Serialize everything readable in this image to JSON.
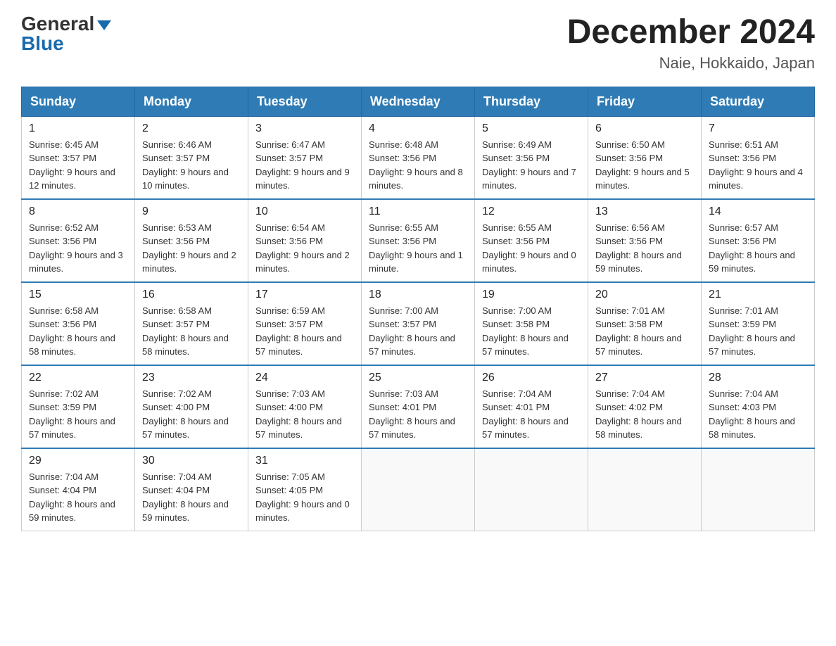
{
  "header": {
    "logo_general": "General",
    "logo_blue": "Blue",
    "month_title": "December 2024",
    "location": "Naie, Hokkaido, Japan"
  },
  "weekdays": [
    "Sunday",
    "Monday",
    "Tuesday",
    "Wednesday",
    "Thursday",
    "Friday",
    "Saturday"
  ],
  "weeks": [
    [
      {
        "day": "1",
        "sunrise": "6:45 AM",
        "sunset": "3:57 PM",
        "daylight": "9 hours and 12 minutes."
      },
      {
        "day": "2",
        "sunrise": "6:46 AM",
        "sunset": "3:57 PM",
        "daylight": "9 hours and 10 minutes."
      },
      {
        "day": "3",
        "sunrise": "6:47 AM",
        "sunset": "3:57 PM",
        "daylight": "9 hours and 9 minutes."
      },
      {
        "day": "4",
        "sunrise": "6:48 AM",
        "sunset": "3:56 PM",
        "daylight": "9 hours and 8 minutes."
      },
      {
        "day": "5",
        "sunrise": "6:49 AM",
        "sunset": "3:56 PM",
        "daylight": "9 hours and 7 minutes."
      },
      {
        "day": "6",
        "sunrise": "6:50 AM",
        "sunset": "3:56 PM",
        "daylight": "9 hours and 5 minutes."
      },
      {
        "day": "7",
        "sunrise": "6:51 AM",
        "sunset": "3:56 PM",
        "daylight": "9 hours and 4 minutes."
      }
    ],
    [
      {
        "day": "8",
        "sunrise": "6:52 AM",
        "sunset": "3:56 PM",
        "daylight": "9 hours and 3 minutes."
      },
      {
        "day": "9",
        "sunrise": "6:53 AM",
        "sunset": "3:56 PM",
        "daylight": "9 hours and 2 minutes."
      },
      {
        "day": "10",
        "sunrise": "6:54 AM",
        "sunset": "3:56 PM",
        "daylight": "9 hours and 2 minutes."
      },
      {
        "day": "11",
        "sunrise": "6:55 AM",
        "sunset": "3:56 PM",
        "daylight": "9 hours and 1 minute."
      },
      {
        "day": "12",
        "sunrise": "6:55 AM",
        "sunset": "3:56 PM",
        "daylight": "9 hours and 0 minutes."
      },
      {
        "day": "13",
        "sunrise": "6:56 AM",
        "sunset": "3:56 PM",
        "daylight": "8 hours and 59 minutes."
      },
      {
        "day": "14",
        "sunrise": "6:57 AM",
        "sunset": "3:56 PM",
        "daylight": "8 hours and 59 minutes."
      }
    ],
    [
      {
        "day": "15",
        "sunrise": "6:58 AM",
        "sunset": "3:56 PM",
        "daylight": "8 hours and 58 minutes."
      },
      {
        "day": "16",
        "sunrise": "6:58 AM",
        "sunset": "3:57 PM",
        "daylight": "8 hours and 58 minutes."
      },
      {
        "day": "17",
        "sunrise": "6:59 AM",
        "sunset": "3:57 PM",
        "daylight": "8 hours and 57 minutes."
      },
      {
        "day": "18",
        "sunrise": "7:00 AM",
        "sunset": "3:57 PM",
        "daylight": "8 hours and 57 minutes."
      },
      {
        "day": "19",
        "sunrise": "7:00 AM",
        "sunset": "3:58 PM",
        "daylight": "8 hours and 57 minutes."
      },
      {
        "day": "20",
        "sunrise": "7:01 AM",
        "sunset": "3:58 PM",
        "daylight": "8 hours and 57 minutes."
      },
      {
        "day": "21",
        "sunrise": "7:01 AM",
        "sunset": "3:59 PM",
        "daylight": "8 hours and 57 minutes."
      }
    ],
    [
      {
        "day": "22",
        "sunrise": "7:02 AM",
        "sunset": "3:59 PM",
        "daylight": "8 hours and 57 minutes."
      },
      {
        "day": "23",
        "sunrise": "7:02 AM",
        "sunset": "4:00 PM",
        "daylight": "8 hours and 57 minutes."
      },
      {
        "day": "24",
        "sunrise": "7:03 AM",
        "sunset": "4:00 PM",
        "daylight": "8 hours and 57 minutes."
      },
      {
        "day": "25",
        "sunrise": "7:03 AM",
        "sunset": "4:01 PM",
        "daylight": "8 hours and 57 minutes."
      },
      {
        "day": "26",
        "sunrise": "7:04 AM",
        "sunset": "4:01 PM",
        "daylight": "8 hours and 57 minutes."
      },
      {
        "day": "27",
        "sunrise": "7:04 AM",
        "sunset": "4:02 PM",
        "daylight": "8 hours and 58 minutes."
      },
      {
        "day": "28",
        "sunrise": "7:04 AM",
        "sunset": "4:03 PM",
        "daylight": "8 hours and 58 minutes."
      }
    ],
    [
      {
        "day": "29",
        "sunrise": "7:04 AM",
        "sunset": "4:04 PM",
        "daylight": "8 hours and 59 minutes."
      },
      {
        "day": "30",
        "sunrise": "7:04 AM",
        "sunset": "4:04 PM",
        "daylight": "8 hours and 59 minutes."
      },
      {
        "day": "31",
        "sunrise": "7:05 AM",
        "sunset": "4:05 PM",
        "daylight": "9 hours and 0 minutes."
      },
      null,
      null,
      null,
      null
    ]
  ]
}
